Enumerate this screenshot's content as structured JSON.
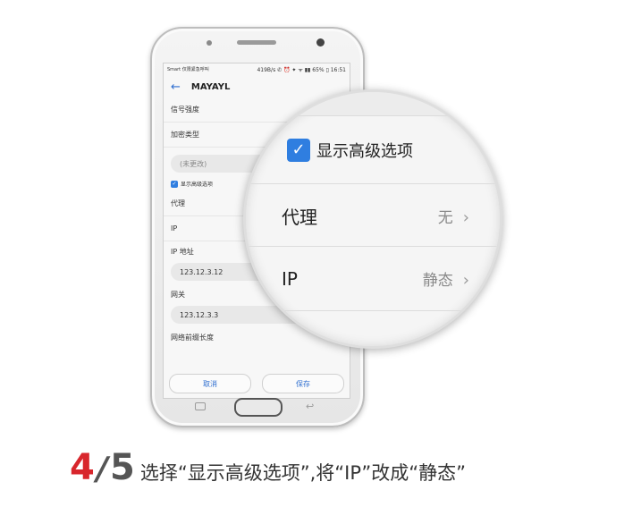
{
  "phone": {
    "status_left": "Smart\n仅限紧急呼叫",
    "status_right": "419B/s ✆ ⏰ ✦ ᯤ ▮▮ 65% ▯ 16:51",
    "app_title": "MAYAYL",
    "rows": [
      "信号强度",
      "加密类型"
    ],
    "password_placeholder": "(未更改)",
    "advanced_checkbox_label": "显示高级选项",
    "proxy_label": "代理",
    "ip_label": "IP",
    "ip_address_label": "IP 地址",
    "ip_address_value": "123.12.3.12",
    "gateway_label": "网关",
    "gateway_value": "123.12.3.3",
    "prefix_label": "网络前缀长度",
    "cancel_label": "取消",
    "save_label": "保存"
  },
  "magnifier": {
    "checkbox_label": "显示高级选项",
    "proxy_label": "代理",
    "proxy_value": "无",
    "ip_label": "IP",
    "ip_value": "静态"
  },
  "caption": {
    "step": "4",
    "separator": "/",
    "total": "5",
    "text": "选择“显示高级选项”,将“IP”改成“静态”"
  },
  "colors": {
    "accent_blue": "#2f7ee0",
    "step_red": "#d8262c"
  }
}
